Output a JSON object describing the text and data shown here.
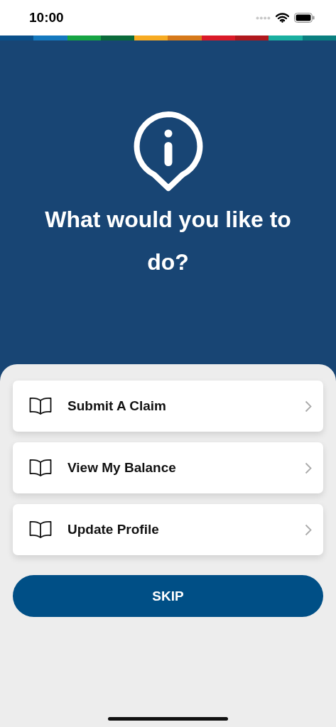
{
  "status_bar": {
    "time": "10:00"
  },
  "color_strip": [
    {
      "color": "#0a4f8a"
    },
    {
      "color": "#1478be"
    },
    {
      "color": "#16a443"
    },
    {
      "color": "#0a6a3a"
    },
    {
      "color": "#f7ab22"
    },
    {
      "color": "#d6791a"
    },
    {
      "color": "#da1a28"
    },
    {
      "color": "#b0181d"
    },
    {
      "color": "#1aafa0"
    },
    {
      "color": "#0a7f80"
    }
  ],
  "heading": "What would you like to do?",
  "options": [
    {
      "label": "Submit A Claim"
    },
    {
      "label": "View My Balance"
    },
    {
      "label": "Update Profile"
    }
  ],
  "skip_button": "SKIP"
}
